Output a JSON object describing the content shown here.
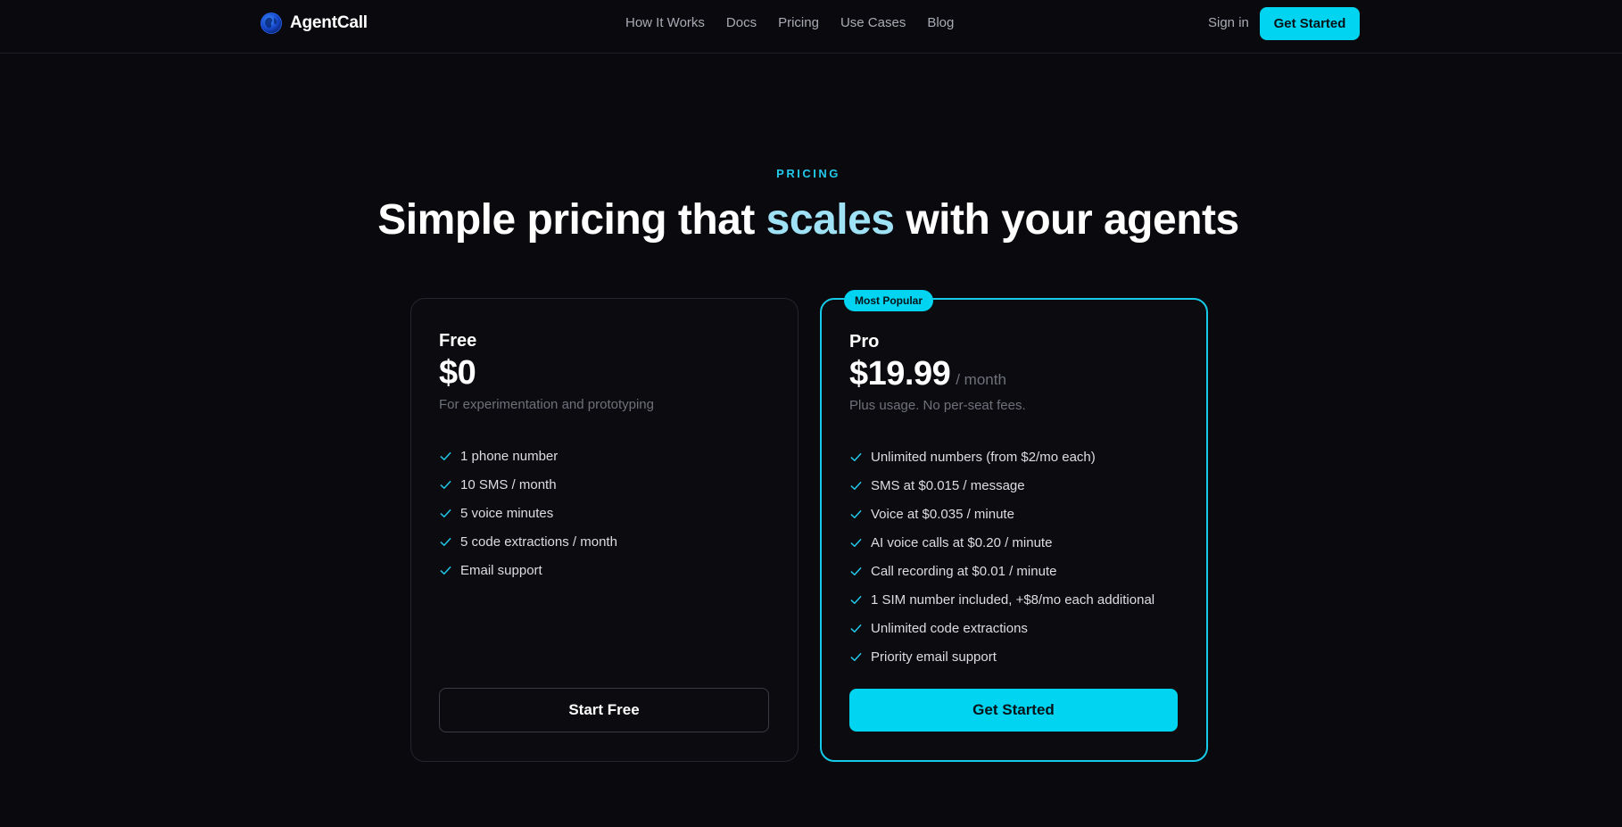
{
  "colors": {
    "background": "#0a0a0e",
    "accent": "#00d4f0",
    "accent_text": "#22c8ea",
    "headline_highlight": "#9fe2f6",
    "muted_text": "#6e707a",
    "border": "#24252d"
  },
  "nav": {
    "brand": "AgentCall",
    "logo_icon": "globe-logo-icon",
    "links": [
      {
        "label": "How It Works"
      },
      {
        "label": "Docs"
      },
      {
        "label": "Pricing"
      },
      {
        "label": "Use Cases"
      },
      {
        "label": "Blog"
      }
    ],
    "signin_label": "Sign in",
    "cta_label": "Get Started"
  },
  "hero": {
    "eyebrow": "PRICING",
    "headline_part1": "Simple pricing that ",
    "headline_accent": "scales",
    "headline_part2": " with your agents"
  },
  "plans": [
    {
      "name": "Free",
      "price": "$0",
      "period": "",
      "description": "For experimentation and prototyping",
      "features": [
        "1 phone number",
        "10 SMS / month",
        "5 voice minutes",
        "5 code extractions / month",
        "Email support"
      ],
      "button_label": "Start Free",
      "feature_icon": "check-icon"
    },
    {
      "name": "Pro",
      "badge": "Most Popular",
      "price": "$19.99",
      "period": "/ month",
      "description": "Plus usage. No per-seat fees.",
      "features": [
        "Unlimited numbers (from $2/mo each)",
        "SMS at $0.015 / message",
        "Voice at $0.035 / minute",
        "AI voice calls at $0.20 / minute",
        "Call recording at $0.01 / minute",
        "1 SIM number included, +$8/mo each additional",
        "Unlimited code extractions",
        "Priority email support"
      ],
      "button_label": "Get Started",
      "feature_icon": "check-icon"
    }
  ]
}
